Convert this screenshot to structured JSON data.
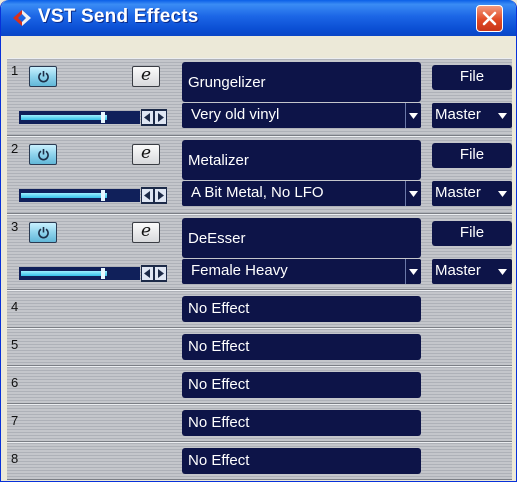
{
  "window": {
    "title": "VST Send Effects",
    "icons": {
      "app": "cubase-logo-icon",
      "close": "close-icon"
    }
  },
  "slots": [
    {
      "number": "1",
      "active": true,
      "effect": "Grungelizer",
      "preset": "Very old vinyl",
      "file_label": "File",
      "output": "Master",
      "send_level": 0.75
    },
    {
      "number": "2",
      "active": true,
      "effect": "Metalizer",
      "preset": "A Bit Metal, No LFO",
      "file_label": "File",
      "output": "Master",
      "send_level": 0.75
    },
    {
      "number": "3",
      "active": true,
      "effect": "DeEsser",
      "preset": "Female Heavy",
      "file_label": "File",
      "output": "Master",
      "send_level": 0.75
    },
    {
      "number": "4",
      "active": false,
      "effect": "No Effect"
    },
    {
      "number": "5",
      "active": false,
      "effect": "No Effect"
    },
    {
      "number": "6",
      "active": false,
      "effect": "No Effect"
    },
    {
      "number": "7",
      "active": false,
      "effect": "No Effect"
    },
    {
      "number": "8",
      "active": false,
      "effect": "No Effect"
    }
  ],
  "icons": {
    "power": "power-icon",
    "edit": "edit-icon",
    "left": "arrow-left-icon",
    "right": "arrow-right-icon",
    "dropdown": "chevron-down-icon"
  },
  "colors": {
    "titlebar": "#0b4fd4",
    "field_bg": "#0d1448",
    "power_on": "#8fd3ec",
    "close": "#e14a25"
  }
}
